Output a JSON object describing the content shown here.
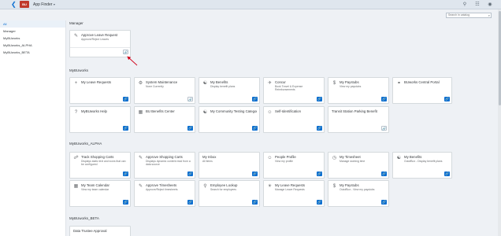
{
  "shell": {
    "logo": "BU",
    "app_title": "App Finder",
    "back_icon": "back-arrow-icon"
  },
  "search": {
    "placeholder": "Search in catalog"
  },
  "sidebar": {
    "items": [
      {
        "label": "All",
        "active": true
      },
      {
        "label": "Manager",
        "active": false
      },
      {
        "label": "MyBUworks",
        "active": false
      },
      {
        "label": "MyBUworks_ALPHA",
        "active": false
      },
      {
        "label": "MyBUworks_BETA",
        "active": false
      }
    ]
  },
  "groups": [
    {
      "title": "Manager",
      "tiles": [
        {
          "title": "Approve Leave Request",
          "subtitle": "Approve/Reject Leaves",
          "icon": "approvals-icon",
          "button": "pin-grey"
        }
      ]
    },
    {
      "title": "MyBUworks",
      "tiles": [
        {
          "title": "My Leave Requests",
          "subtitle": "",
          "icon": "add-icon",
          "button": "pin"
        },
        {
          "title": "System Maintenance",
          "subtitle": "None Currently",
          "icon": "gear-icon",
          "button": "pin-grey"
        },
        {
          "title": "My Benefits",
          "subtitle": "Display benefit plans",
          "icon": "people-icon",
          "button": "pin"
        },
        {
          "title": "Concur",
          "subtitle": "Book Travel & Expense Reimbursements",
          "icon": "travel-icon",
          "button": "pin"
        },
        {
          "title": "My Paystubs",
          "subtitle": "View my paystubs",
          "icon": "money-icon",
          "button": "pin"
        },
        {
          "title": "BUworks Central Portal",
          "subtitle": "",
          "icon": "link-icon",
          "button": "pin"
        },
        {
          "title": "MyBUworks Help",
          "subtitle": "",
          "icon": "help-icon",
          "button": "pin"
        },
        {
          "title": "BU Benefits Center",
          "subtitle": "",
          "icon": "building-icon",
          "button": "pin"
        },
        {
          "title": "My Community Testing Category",
          "subtitle": "",
          "icon": "community-icon",
          "button": "pin"
        },
        {
          "title": "Self-Identification",
          "subtitle": "",
          "icon": "person-icon",
          "button": "pin"
        },
        {
          "title": "Transit Station Parking Benefit",
          "subtitle": "",
          "icon": "",
          "button": "pin-grey"
        }
      ]
    },
    {
      "title": "MyBUworks_ALPHA",
      "tiles": [
        {
          "title": "Track Shopping Carts",
          "subtitle": "Displays static text and icons that can be configured",
          "icon": "cart-icon",
          "button": "pin"
        },
        {
          "title": "Approve Shopping Carts",
          "subtitle": "Displays dynamic content read from a data source",
          "icon": "approvals-icon",
          "button": "pin"
        },
        {
          "title": "My Inbox",
          "subtitle": "All items",
          "icon": "",
          "button": "pin"
        },
        {
          "title": "People Profile",
          "subtitle": "View my profile",
          "icon": "person-icon",
          "button": "pin"
        },
        {
          "title": "My Timesheet",
          "subtitle": "Manage working time",
          "icon": "clock-icon",
          "button": "pin"
        },
        {
          "title": "My Benefits",
          "subtitle": "OutofBox - Display benefit plans",
          "icon": "people-icon",
          "button": "pin"
        },
        {
          "title": "My Team Calendar",
          "subtitle": "View my team calendar",
          "icon": "calendar-icon",
          "button": "pin"
        },
        {
          "title": "Approve Timesheets",
          "subtitle": "Approve/Reject timesheets",
          "icon": "approvals-icon",
          "button": "pin"
        },
        {
          "title": "Employee Lookup",
          "subtitle": "Search for employees",
          "icon": "search-people-icon",
          "button": "pin"
        },
        {
          "title": "My Leave Requests",
          "subtitle": "Manage Leave Requests",
          "icon": "leave-icon",
          "button": "pin"
        },
        {
          "title": "My Paystubs",
          "subtitle": "OutofBox - View my paystubs",
          "icon": "money-icon",
          "button": "pin"
        }
      ]
    },
    {
      "title": "MyBUworks_BETA",
      "tiles": [
        {
          "title": "Data Trustee Approval",
          "subtitle": "",
          "icon": "",
          "button": ""
        }
      ]
    }
  ],
  "colors": {
    "accent": "#0a6ed1",
    "logo": "#c0392b",
    "annotation_arrow": "#d0021b"
  }
}
